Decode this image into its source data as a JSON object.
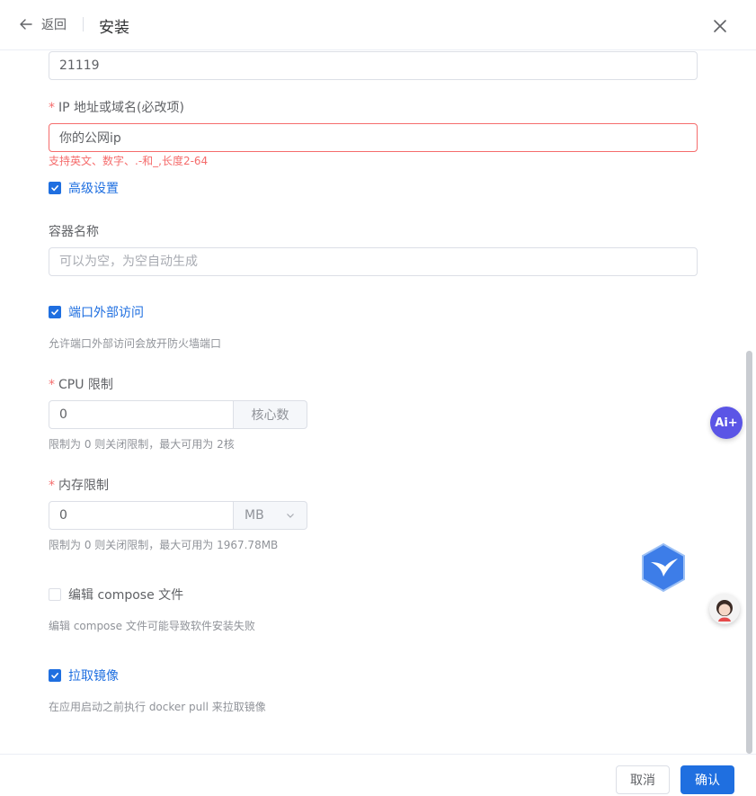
{
  "header": {
    "back_label": "返回",
    "title": "安装"
  },
  "form": {
    "port_value": "21119",
    "ip_label": "IP 地址或域名(必改项)",
    "ip_value": "你的公网ip",
    "ip_error": "支持英文、数字、.-和_,长度2-64",
    "advanced_label": "高级设置",
    "container_label": "容器名称",
    "container_placeholder": "可以为空，为空自动生成",
    "port_external_label": "端口外部访问",
    "port_external_hint": "允许端口外部访问会放开防火墙端口",
    "cpu_label": "CPU 限制",
    "cpu_value": "0",
    "cpu_unit": "核心数",
    "cpu_hint": "限制为 0 则关闭限制，最大可用为 2核",
    "mem_label": "内存限制",
    "mem_value": "0",
    "mem_unit": "MB",
    "mem_hint": "限制为 0 则关闭限制，最大可用为 1967.78MB",
    "compose_label": "编辑 compose 文件",
    "compose_hint": "编辑 compose 文件可能导致软件安装失败",
    "pull_label": "拉取镜像",
    "pull_hint": "在应用启动之前执行 docker pull 来拉取镜像"
  },
  "footer": {
    "cancel_label": "取消",
    "confirm_label": "确认"
  },
  "floating": {
    "ai_label": "Ai+"
  },
  "colors": {
    "accent": "#1f6fe0",
    "error": "#f56c6c",
    "ai_button": "#5b55e6"
  }
}
